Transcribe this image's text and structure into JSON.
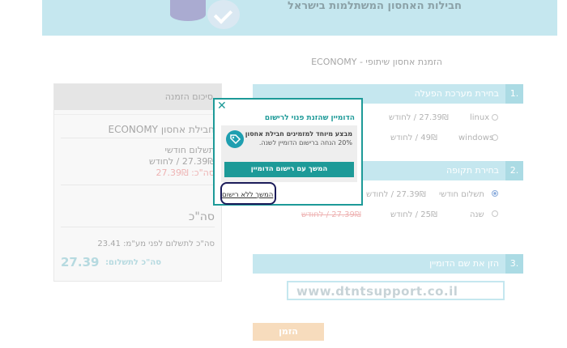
{
  "banner": {
    "title": "חבילות האחסון המשתלמות בישראל"
  },
  "breadcrumb": "הזמנת אחסון שיתופי - ECONOMY",
  "summary": {
    "header": "סיכום הזמנה",
    "plan_name": "חבילת אחסון ECONOMY",
    "billing_label": "תשלום חודשי",
    "price_line": "27.39₪ / לחודש",
    "subtotal_line": "סה\"כ: 27.39₪",
    "total_heading": "סה\"כ",
    "before_vat_line": "סה\"כ לתשלום לפני מע\"מ: 23.41",
    "total_label": "סה\"כ לתשלום:",
    "total_value": "27.39"
  },
  "sections": {
    "os": {
      "number": "1.",
      "label": "בחירת מערכת הפעלה",
      "options": [
        {
          "name": "linux",
          "price": "27.39₪ / לחודש"
        },
        {
          "name": "windows",
          "price": "49₪ / לחודש"
        }
      ]
    },
    "period": {
      "number": "2.",
      "label": "בחירת תקופה",
      "options": [
        {
          "name": "תשלום חודשי",
          "price": "27.39₪ / לחודש",
          "old_price": ""
        },
        {
          "name": "שנה",
          "price": "25₪ / לחודש",
          "old_price": "27.39₪ / לחודש"
        }
      ]
    },
    "domain": {
      "number": "3.",
      "label": "הזן את שם הדומיין",
      "value": "www.dtntsupport.co.il"
    }
  },
  "order_button": "הזמן",
  "modal": {
    "close": "✕",
    "title": "הדומיין שהזנת פנוי לרישום",
    "promo_title": "מבצע מיוחד למזמינים חבילת אחסון",
    "promo_text": "20% הנחה ברישום הדומיין לשנה.",
    "primary_button": "המשך עם רישום הדומיין",
    "skip_link": "המשך ללא רישום"
  },
  "colors": {
    "accent": "#1d9a98",
    "banner": "#a6dbe6",
    "highlight": "#1c1c5a"
  }
}
